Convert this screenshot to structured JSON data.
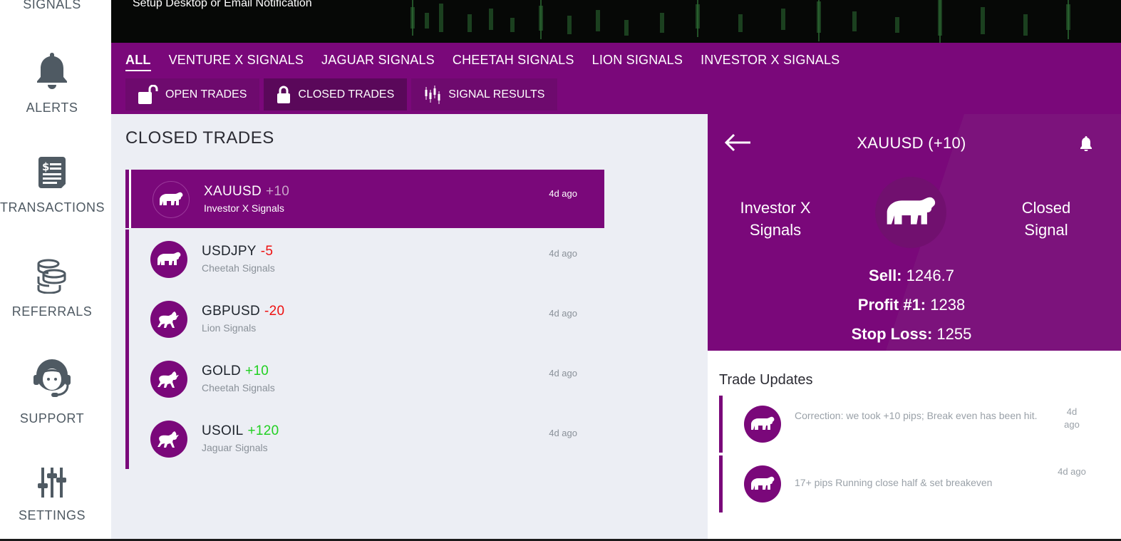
{
  "sidebar": {
    "items": [
      {
        "label": "SIGNALS",
        "icon": "signals-icon"
      },
      {
        "label": "ALERTS",
        "icon": "bell-icon"
      },
      {
        "label": "TRANSACTIONS",
        "icon": "receipt-icon"
      },
      {
        "label": "REFERRALS",
        "icon": "coins-icon"
      },
      {
        "label": "SUPPORT",
        "icon": "headset-icon"
      },
      {
        "label": "SETTINGS",
        "icon": "sliders-icon"
      }
    ]
  },
  "banner": {
    "text": "Setup Desktop or Email Notification"
  },
  "filters": [
    "ALL",
    "VENTURE X SIGNALS",
    "JAGUAR SIGNALS",
    "CHEETAH SIGNALS",
    "LION SIGNALS",
    "INVESTOR X SIGNALS"
  ],
  "active_filter": "ALL",
  "tabs": [
    {
      "label": "OPEN TRADES",
      "icon": "unlock-icon"
    },
    {
      "label": "CLOSED TRADES",
      "icon": "lock-icon"
    },
    {
      "label": "SIGNAL RESULTS",
      "icon": "candlestick-icon"
    }
  ],
  "active_tab": "CLOSED TRADES",
  "main": {
    "title": "CLOSED TRADES",
    "trades": [
      {
        "symbol": "XAUUSD",
        "pips": "+10",
        "provider": "Investor X Signals",
        "time": "4d ago",
        "direction": "bear"
      },
      {
        "symbol": "USDJPY",
        "pips": "-5",
        "provider": "Cheetah Signals",
        "time": "4d ago",
        "direction": "bear"
      },
      {
        "symbol": "GBPUSD",
        "pips": "-20",
        "provider": "Lion Signals",
        "time": "4d ago",
        "direction": "bull"
      },
      {
        "symbol": "GOLD",
        "pips": "+10",
        "provider": "Cheetah Signals",
        "time": "4d ago",
        "direction": "bull"
      },
      {
        "symbol": "USOIL",
        "pips": "+120",
        "provider": "Jaguar Signals",
        "time": "4d ago",
        "direction": "bull"
      }
    ]
  },
  "detail": {
    "title": "XAUUSD (+10)",
    "provider_line1": "Investor X",
    "provider_line2": "Signals",
    "status_line1": "Closed",
    "status_line2": "Signal",
    "sell_label": "Sell:",
    "sell_value": "1246.7",
    "profit_label": "Profit #1:",
    "profit_value": "1238",
    "stoploss_label": "Stop Loss:",
    "stoploss_value": "1255"
  },
  "updates": {
    "title": "Trade Updates",
    "items": [
      {
        "text": "Correction: we took +10 pips; Break even has been hit.",
        "time_line1": "4d",
        "time_line2": "ago"
      },
      {
        "text": "17+ pips Running close half & set breakeven",
        "time_line1": "4d ago",
        "time_line2": ""
      }
    ]
  },
  "colors": {
    "purple": "#7a087a",
    "positive": "#22d022",
    "negative": "#ee1111",
    "list_background": "#eceef4"
  }
}
